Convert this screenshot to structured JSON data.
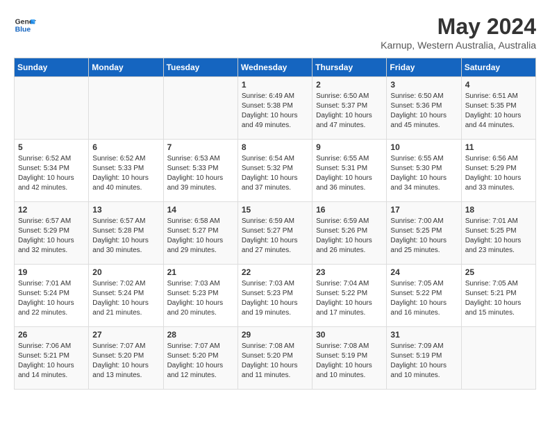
{
  "header": {
    "logo_line1": "General",
    "logo_line2": "Blue",
    "month_title": "May 2024",
    "subtitle": "Karnup, Western Australia, Australia"
  },
  "days_of_week": [
    "Sunday",
    "Monday",
    "Tuesday",
    "Wednesday",
    "Thursday",
    "Friday",
    "Saturday"
  ],
  "weeks": [
    [
      {
        "day": "",
        "info": ""
      },
      {
        "day": "",
        "info": ""
      },
      {
        "day": "",
        "info": ""
      },
      {
        "day": "1",
        "info": "Sunrise: 6:49 AM\nSunset: 5:38 PM\nDaylight: 10 hours\nand 49 minutes."
      },
      {
        "day": "2",
        "info": "Sunrise: 6:50 AM\nSunset: 5:37 PM\nDaylight: 10 hours\nand 47 minutes."
      },
      {
        "day": "3",
        "info": "Sunrise: 6:50 AM\nSunset: 5:36 PM\nDaylight: 10 hours\nand 45 minutes."
      },
      {
        "day": "4",
        "info": "Sunrise: 6:51 AM\nSunset: 5:35 PM\nDaylight: 10 hours\nand 44 minutes."
      }
    ],
    [
      {
        "day": "5",
        "info": "Sunrise: 6:52 AM\nSunset: 5:34 PM\nDaylight: 10 hours\nand 42 minutes."
      },
      {
        "day": "6",
        "info": "Sunrise: 6:52 AM\nSunset: 5:33 PM\nDaylight: 10 hours\nand 40 minutes."
      },
      {
        "day": "7",
        "info": "Sunrise: 6:53 AM\nSunset: 5:33 PM\nDaylight: 10 hours\nand 39 minutes."
      },
      {
        "day": "8",
        "info": "Sunrise: 6:54 AM\nSunset: 5:32 PM\nDaylight: 10 hours\nand 37 minutes."
      },
      {
        "day": "9",
        "info": "Sunrise: 6:55 AM\nSunset: 5:31 PM\nDaylight: 10 hours\nand 36 minutes."
      },
      {
        "day": "10",
        "info": "Sunrise: 6:55 AM\nSunset: 5:30 PM\nDaylight: 10 hours\nand 34 minutes."
      },
      {
        "day": "11",
        "info": "Sunrise: 6:56 AM\nSunset: 5:29 PM\nDaylight: 10 hours\nand 33 minutes."
      }
    ],
    [
      {
        "day": "12",
        "info": "Sunrise: 6:57 AM\nSunset: 5:29 PM\nDaylight: 10 hours\nand 32 minutes."
      },
      {
        "day": "13",
        "info": "Sunrise: 6:57 AM\nSunset: 5:28 PM\nDaylight: 10 hours\nand 30 minutes."
      },
      {
        "day": "14",
        "info": "Sunrise: 6:58 AM\nSunset: 5:27 PM\nDaylight: 10 hours\nand 29 minutes."
      },
      {
        "day": "15",
        "info": "Sunrise: 6:59 AM\nSunset: 5:27 PM\nDaylight: 10 hours\nand 27 minutes."
      },
      {
        "day": "16",
        "info": "Sunrise: 6:59 AM\nSunset: 5:26 PM\nDaylight: 10 hours\nand 26 minutes."
      },
      {
        "day": "17",
        "info": "Sunrise: 7:00 AM\nSunset: 5:25 PM\nDaylight: 10 hours\nand 25 minutes."
      },
      {
        "day": "18",
        "info": "Sunrise: 7:01 AM\nSunset: 5:25 PM\nDaylight: 10 hours\nand 23 minutes."
      }
    ],
    [
      {
        "day": "19",
        "info": "Sunrise: 7:01 AM\nSunset: 5:24 PM\nDaylight: 10 hours\nand 22 minutes."
      },
      {
        "day": "20",
        "info": "Sunrise: 7:02 AM\nSunset: 5:24 PM\nDaylight: 10 hours\nand 21 minutes."
      },
      {
        "day": "21",
        "info": "Sunrise: 7:03 AM\nSunset: 5:23 PM\nDaylight: 10 hours\nand 20 minutes."
      },
      {
        "day": "22",
        "info": "Sunrise: 7:03 AM\nSunset: 5:23 PM\nDaylight: 10 hours\nand 19 minutes."
      },
      {
        "day": "23",
        "info": "Sunrise: 7:04 AM\nSunset: 5:22 PM\nDaylight: 10 hours\nand 17 minutes."
      },
      {
        "day": "24",
        "info": "Sunrise: 7:05 AM\nSunset: 5:22 PM\nDaylight: 10 hours\nand 16 minutes."
      },
      {
        "day": "25",
        "info": "Sunrise: 7:05 AM\nSunset: 5:21 PM\nDaylight: 10 hours\nand 15 minutes."
      }
    ],
    [
      {
        "day": "26",
        "info": "Sunrise: 7:06 AM\nSunset: 5:21 PM\nDaylight: 10 hours\nand 14 minutes."
      },
      {
        "day": "27",
        "info": "Sunrise: 7:07 AM\nSunset: 5:20 PM\nDaylight: 10 hours\nand 13 minutes."
      },
      {
        "day": "28",
        "info": "Sunrise: 7:07 AM\nSunset: 5:20 PM\nDaylight: 10 hours\nand 12 minutes."
      },
      {
        "day": "29",
        "info": "Sunrise: 7:08 AM\nSunset: 5:20 PM\nDaylight: 10 hours\nand 11 minutes."
      },
      {
        "day": "30",
        "info": "Sunrise: 7:08 AM\nSunset: 5:19 PM\nDaylight: 10 hours\nand 10 minutes."
      },
      {
        "day": "31",
        "info": "Sunrise: 7:09 AM\nSunset: 5:19 PM\nDaylight: 10 hours\nand 10 minutes."
      },
      {
        "day": "",
        "info": ""
      }
    ]
  ]
}
